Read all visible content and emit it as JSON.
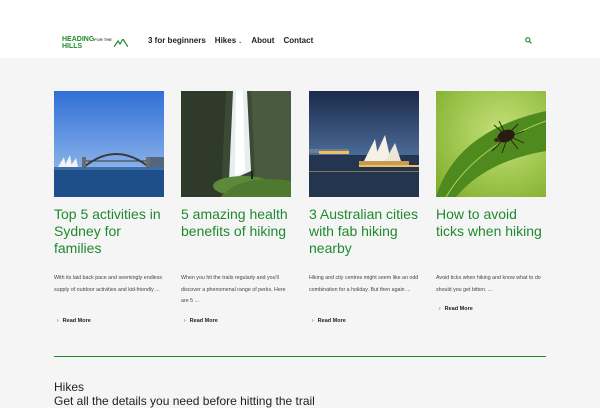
{
  "header": {
    "logo": {
      "line1": "HEADING",
      "small": "FOR THE",
      "line2": "HILLS"
    },
    "nav": [
      {
        "label": "3 for beginners"
      },
      {
        "label": "Hikes"
      },
      {
        "label": "About"
      },
      {
        "label": "Contact"
      }
    ],
    "search_icon": "search-icon"
  },
  "cards": [
    {
      "title": "Top 5 activities in Sydney for families",
      "excerpt": "With its laid back pace and seemingly endless supply of outdoor activities and kid-friendly ...",
      "read_more": "Read More",
      "image": "sydney-harbour-bridge"
    },
    {
      "title": "5 amazing health benefits of hiking",
      "excerpt": "When you hit the trails regularly and you'll discover a phenomenal range of perks. Here are 5   ...",
      "read_more": "Read More",
      "image": "waterfall-hiker"
    },
    {
      "title": "3 Australian cities with fab hiking nearby",
      "excerpt": "Hiking and city centres might seem like an odd combination for a holiday. But then again ...",
      "read_more": "Read More",
      "image": "sydney-opera-house-night"
    },
    {
      "title": "How to avoid ticks when hiking",
      "excerpt": "Avoid ticks when hiking and know what to do should you get bitten.     ...",
      "read_more": "Read More",
      "image": "tick-on-leaf"
    }
  ],
  "section": {
    "title": "Hikes",
    "subtitle": "Get all the details you need before hitting the trail"
  },
  "colors": {
    "accent": "#1e8a2e",
    "background": "#f5f5f5",
    "header": "#ffffff"
  }
}
